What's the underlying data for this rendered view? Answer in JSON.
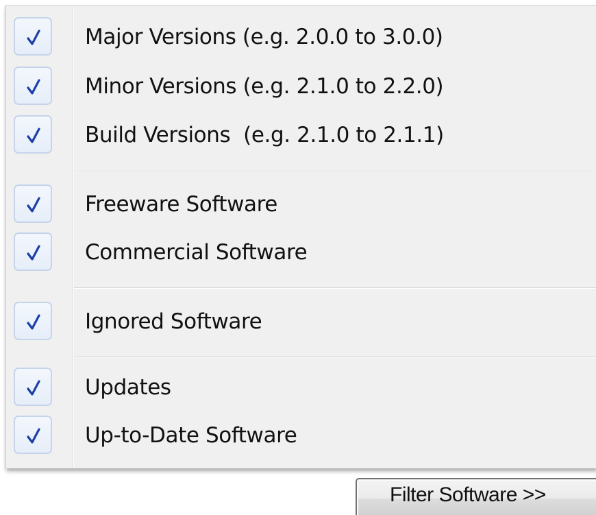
{
  "menu": {
    "items": [
      {
        "label": "Major Versions (e.g. 2.0.0 to 3.0.0)",
        "checked": true,
        "icon": "checkmark-icon"
      },
      {
        "label": "Minor Versions (e.g. 2.1.0 to 2.2.0)",
        "checked": true,
        "icon": "checkmark-icon"
      },
      {
        "label": "Build Versions  (e.g. 2.1.0 to 2.1.1)",
        "checked": true,
        "icon": "checkmark-icon"
      },
      {
        "label": "Freeware Software",
        "checked": true,
        "icon": "checkmark-icon"
      },
      {
        "label": "Commercial Software",
        "checked": true,
        "icon": "checkmark-icon"
      },
      {
        "label": "Ignored Software",
        "checked": true,
        "icon": "checkmark-icon"
      },
      {
        "label": "Updates",
        "checked": true,
        "icon": "checkmark-icon"
      },
      {
        "label": "Up-to-Date Software",
        "checked": true,
        "icon": "checkmark-icon"
      }
    ]
  },
  "filter_button": {
    "label": "Filter Software >>"
  },
  "colors": {
    "menu_background": "#f0f0f0",
    "checkmark": "#1c3fa6",
    "check_border": "#c6d4ea"
  }
}
